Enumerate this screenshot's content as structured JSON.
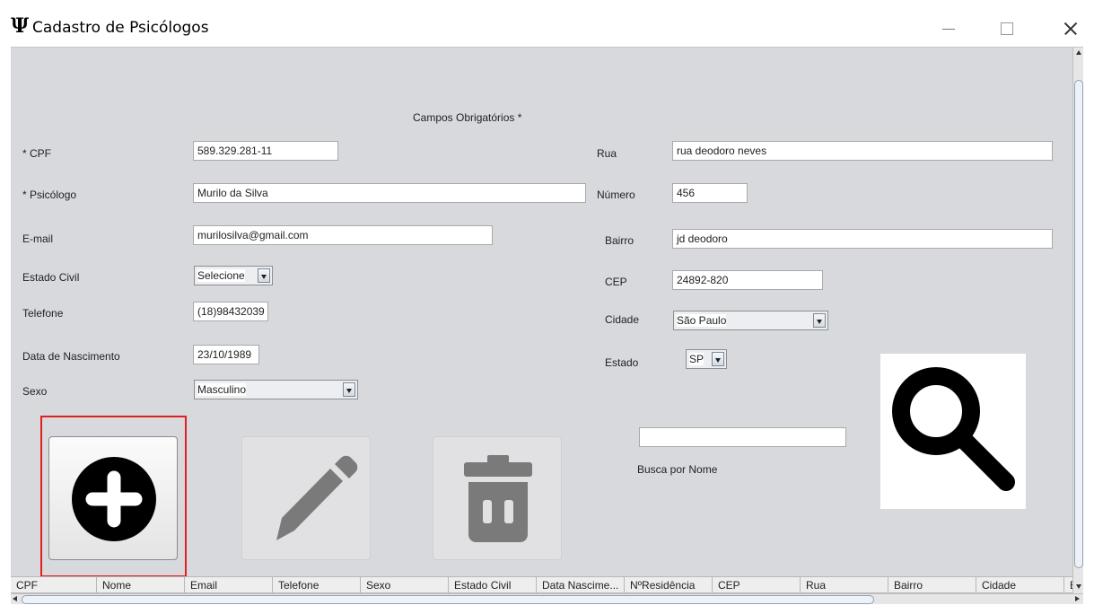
{
  "window": {
    "icon": "Ψ",
    "title": "Cadastro de Psicólogos"
  },
  "form": {
    "required_note": "Campos Obrigatórios *",
    "cpf_label": "* CPF",
    "cpf_value": "589.329.281-11",
    "psicologo_label": "* Psicólogo",
    "psicologo_value": "Murilo da Silva",
    "email_label": "E-mail",
    "email_value": "murilosilva@gmail.com",
    "estado_civil_label": "Estado Civil",
    "estado_civil_value": "Selecione",
    "telefone_label": "Telefone",
    "telefone_value": "(18)98432039",
    "nascimento_label": "Data de Nascimento",
    "nascimento_value": "23/10/1989",
    "sexo_label": "Sexo",
    "sexo_value": "Masculino",
    "rua_label": "Rua",
    "rua_value": "rua deodoro neves",
    "numero_label": "Número",
    "numero_value": "456",
    "bairro_label": "Bairro",
    "bairro_value": "jd deodoro",
    "cep_label": "CEP",
    "cep_value": "24892-820",
    "cidade_label": "Cidade",
    "cidade_value": "São Paulo",
    "estado_label": "Estado",
    "estado_value": "SP"
  },
  "search": {
    "value": "",
    "label": "Busca por Nome"
  },
  "icons": {
    "add": "plus-circle-icon",
    "edit": "pencil-icon",
    "delete": "trash-icon",
    "search": "magnifier-icon"
  },
  "table": {
    "columns": [
      "CPF",
      "Nome",
      "Email",
      "Telefone",
      "Sexo",
      "Estado Civil",
      "Data Nascime...",
      "NºResidência",
      "CEP",
      "Rua",
      "Bairro",
      "Cidade",
      "E"
    ]
  }
}
